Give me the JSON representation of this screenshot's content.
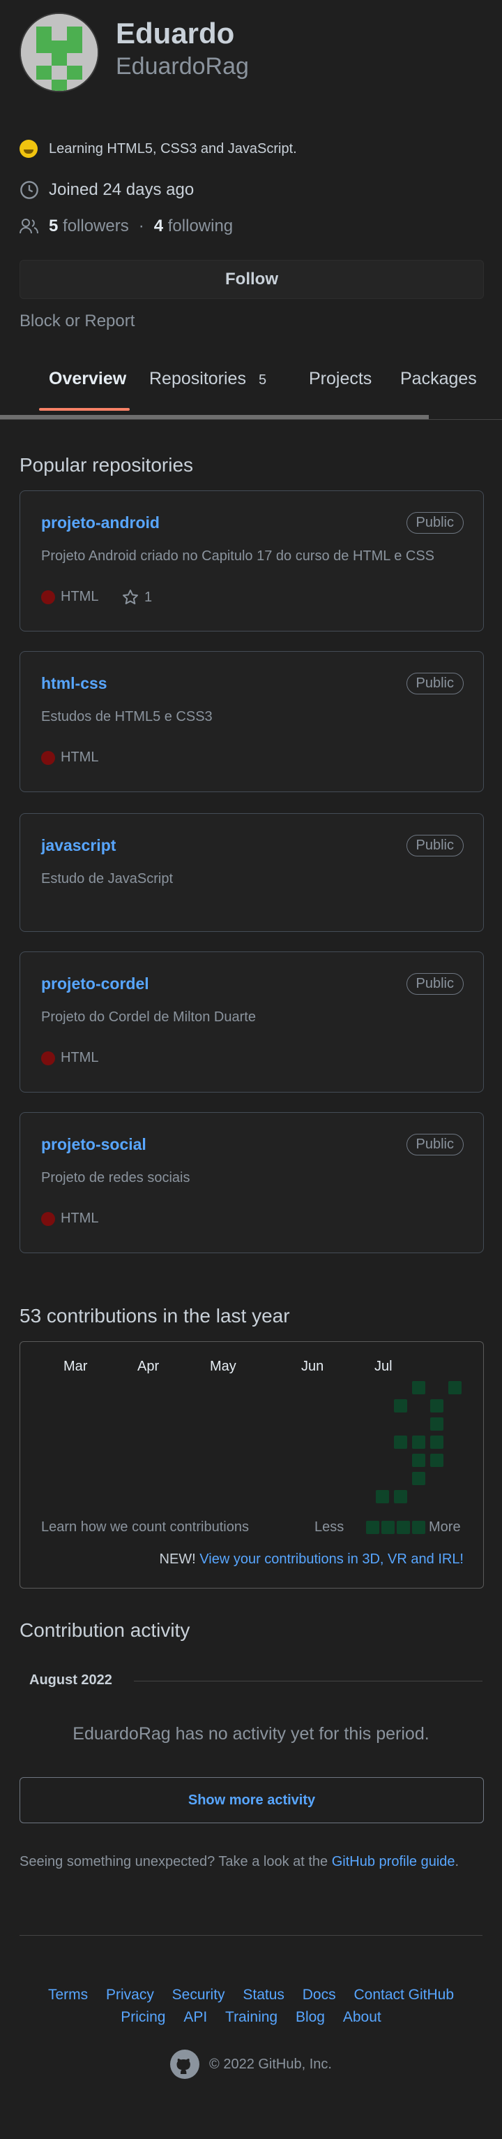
{
  "profile": {
    "name": "Eduardo",
    "login": "EduardoRag",
    "bio": "Learning HTML5, CSS3 and JavaScript.",
    "joined": "Joined 24 days ago",
    "followers_count": "5",
    "followers_label": "followers",
    "separator": "·",
    "following_count": "4",
    "following_label": "following",
    "follow_button": "Follow",
    "block_report": "Block or Report"
  },
  "tabs": [
    {
      "label": "Overview",
      "active": true
    },
    {
      "label": "Repositories",
      "count": "5"
    },
    {
      "label": "Projects"
    },
    {
      "label": "Packages"
    }
  ],
  "popular": {
    "title": "Popular repositories",
    "repos": [
      {
        "name": "projeto-android",
        "badge": "Public",
        "description": "Projeto Android criado no Capitulo 17 do curso de HTML e CSS",
        "language": "HTML",
        "stars": "1"
      },
      {
        "name": "html-css",
        "badge": "Public",
        "description": "Estudos de HTML5 e CSS3",
        "language": "HTML"
      },
      {
        "name": "javascript",
        "badge": "Public",
        "description": "Estudo de JavaScript"
      },
      {
        "name": "projeto-cordel",
        "badge": "Public",
        "description": "Projeto do Cordel de Milton Duarte",
        "language": "HTML"
      },
      {
        "name": "projeto-social",
        "badge": "Public",
        "description": "Projeto de redes sociais",
        "language": "HTML"
      }
    ]
  },
  "contributions": {
    "title": "53 contributions in the last year",
    "months": [
      "Mar",
      "Apr",
      "May",
      "Jun",
      "Jul"
    ],
    "learn": "Learn how we count contributions",
    "less": "Less",
    "more": "More",
    "new_prefix": "NEW!",
    "new_link": "View your contributions in 3D, VR and IRL!",
    "cell_color": "#0e4429"
  },
  "activity": {
    "title": "Contribution activity",
    "period": "August 2022",
    "empty": "EduardoRag has no activity yet for this period.",
    "show_more": "Show more activity",
    "unexpected": "Seeing something unexpected? Take a look at the",
    "guide_link": "GitHub profile guide",
    "guide_suffix": "."
  },
  "footer": {
    "row1": [
      "Terms",
      "Privacy",
      "Security",
      "Status",
      "Docs",
      "Contact GitHub"
    ],
    "row2": [
      "Pricing",
      "API",
      "Training",
      "Blog",
      "About"
    ],
    "copyright": "© 2022 GitHub, Inc."
  },
  "colors": {
    "accent": "#58a6ff",
    "tab_underline": "#f78166",
    "language_html": "#7a0d0d"
  }
}
